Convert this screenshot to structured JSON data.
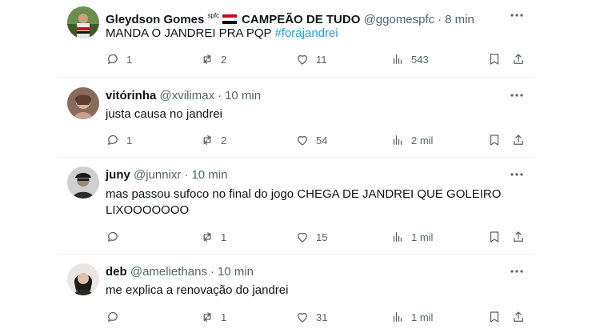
{
  "tweets": [
    {
      "name": "Gleydson Gomes",
      "name_suffix": "spfc",
      "name_extra": "CAMPEÃO DE TUDO",
      "handle": "@ggomespfc",
      "time": "8 min",
      "text": "MANDA O JANDREI PRA PQP ",
      "hashtag": "#forajandrei",
      "replies": "1",
      "reposts": "2",
      "likes": "11",
      "views": "543"
    },
    {
      "name": "vitórinha",
      "handle": "@xvilimax",
      "time": "10 min",
      "text": "justa causa no jandrei",
      "replies": "1",
      "reposts": "2",
      "likes": "54",
      "views": "2 mil"
    },
    {
      "name": "juny",
      "handle": "@junnixr",
      "time": "10 min",
      "text": "mas passou sufoco no final do jogo CHEGA DE JANDREI QUE GOLEIRO LIXOOOOOOO",
      "replies": "",
      "reposts": "1",
      "likes": "15",
      "views": "1 mil"
    },
    {
      "name": "deb",
      "handle": "@ameliethans",
      "time": "10 min",
      "text": "me explica a renovação do jandrei",
      "replies": "",
      "reposts": "1",
      "likes": "31",
      "views": "1 mil"
    }
  ],
  "colors": {
    "accent": "#1d9bf0",
    "muted": "#536471",
    "text": "#0f1419"
  },
  "icons": [
    "reply-icon",
    "repost-icon",
    "like-icon",
    "views-icon",
    "bookmark-icon",
    "share-icon",
    "more-icon",
    "flag-icon"
  ]
}
